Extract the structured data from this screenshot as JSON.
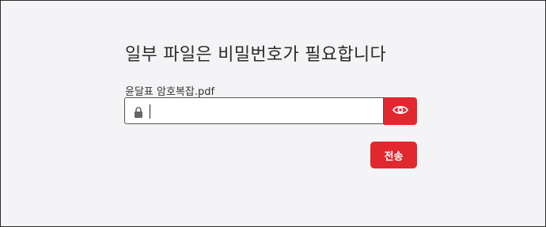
{
  "dialog": {
    "title": "일부 파일은 비밀번호가 필요합니다",
    "file_name": "윤달표 암호복잡.pdf",
    "password_value": "",
    "password_placeholder": "",
    "submit_label": "전송"
  },
  "icons": {
    "lock": "lock-icon",
    "eye": "eye-icon"
  },
  "colors": {
    "accent": "#e0282e",
    "background": "#f4f4f6",
    "text": "#2b2b2b"
  }
}
